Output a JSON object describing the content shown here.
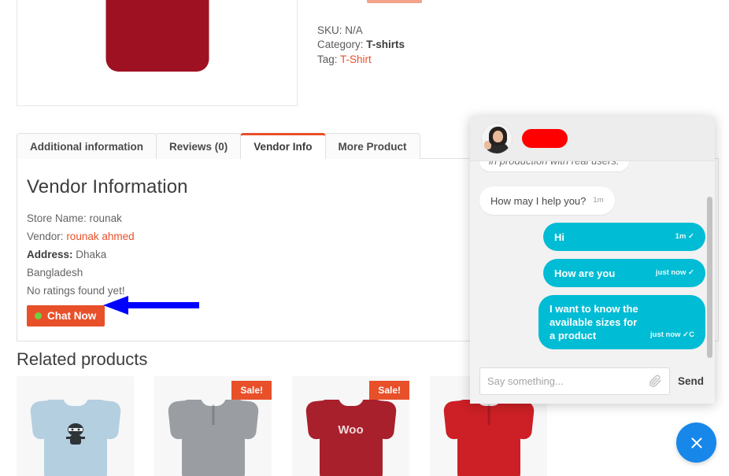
{
  "product_meta": {
    "sku_label": "SKU:",
    "sku_value": "N/A",
    "category_label": "Category:",
    "category_value": "T-shirts",
    "tag_label": "Tag:",
    "tag_value": "T-Shirt"
  },
  "tabs": [
    {
      "label": "Additional information",
      "active": false
    },
    {
      "label": "Reviews (0)",
      "active": false
    },
    {
      "label": "Vendor Info",
      "active": true
    },
    {
      "label": "More Product",
      "active": false
    }
  ],
  "vendor": {
    "heading": "Vendor Information",
    "store_name_label": "Store Name:",
    "store_name_value": "rounak",
    "vendor_label": "Vendor:",
    "vendor_value": "rounak ahmed",
    "address_label": "Address:",
    "address_value": "Dhaka",
    "country": "Bangladesh",
    "ratings": "No ratings found yet!",
    "chat_button": "Chat Now"
  },
  "related": {
    "heading": "Related products",
    "sale_badge": "Sale!",
    "products": [
      {
        "name": "ninja-tee",
        "print": "",
        "sale": false,
        "color": "#b4cfe0"
      },
      {
        "name": "polo-grey",
        "print": "",
        "sale": true,
        "color": "#9a9ea3"
      },
      {
        "name": "woo-tee",
        "print": "Woo",
        "sale": true,
        "color": "#a8202c"
      },
      {
        "name": "red-polo",
        "print": "",
        "sale": false,
        "color": "#cc2026"
      }
    ]
  },
  "chat": {
    "agent_name": "",
    "messages": [
      {
        "text": "in production with real users.",
        "direction": "in",
        "stamp": "",
        "clipped": true
      },
      {
        "text": "How may I help you?",
        "direction": "in",
        "stamp": "1m"
      },
      {
        "text": "Hi",
        "direction": "out",
        "stamp": "1m ✓"
      },
      {
        "text": "How are you",
        "direction": "out",
        "stamp": "just now ✓"
      },
      {
        "text": "I want to know the available sizes for a product",
        "direction": "out",
        "stamp": "just now ✓C"
      }
    ],
    "input_placeholder": "Say something...",
    "input_value": "",
    "send_label": "Send"
  },
  "colors": {
    "accent_orange": "#e8502a",
    "chat_cyan": "#00bcd4",
    "fab_blue": "#1787ea",
    "annotation_blue": "#0000ff",
    "status_green": "#6fcf3f",
    "redaction_red": "#fe0000"
  }
}
